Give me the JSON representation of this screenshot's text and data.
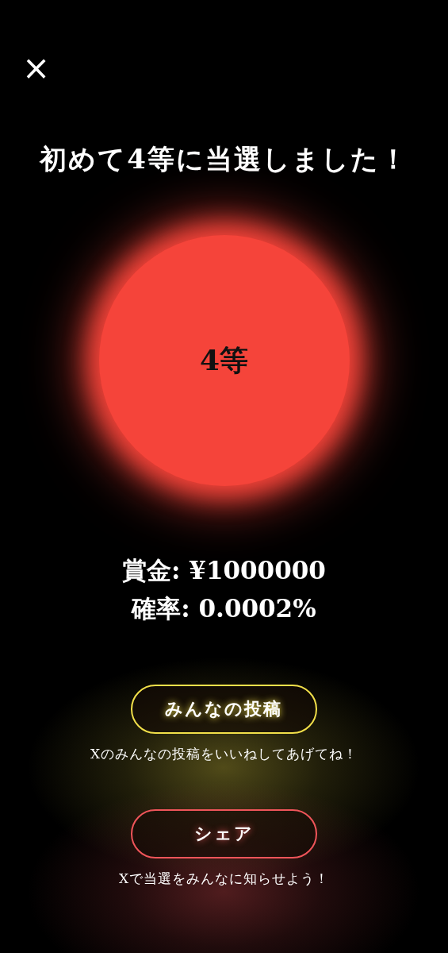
{
  "close_button": {
    "label": "×"
  },
  "title": "初めて4等に当選しました！",
  "prize_badge": {
    "label": "4等",
    "color": "#f5443a"
  },
  "details": [
    {
      "label": "賞金:",
      "value": "¥1000000"
    },
    {
      "label": "確率:",
      "value": "0.0002%"
    }
  ],
  "actions": [
    {
      "label": "みんなの投稿",
      "caption": "Xのみんなの投稿をいいねしてあげてね！",
      "color": "#f2e04a"
    },
    {
      "label": "シェア",
      "caption": "Xで当選をみんなに知らせよう！",
      "color": "#f0555a"
    }
  ]
}
